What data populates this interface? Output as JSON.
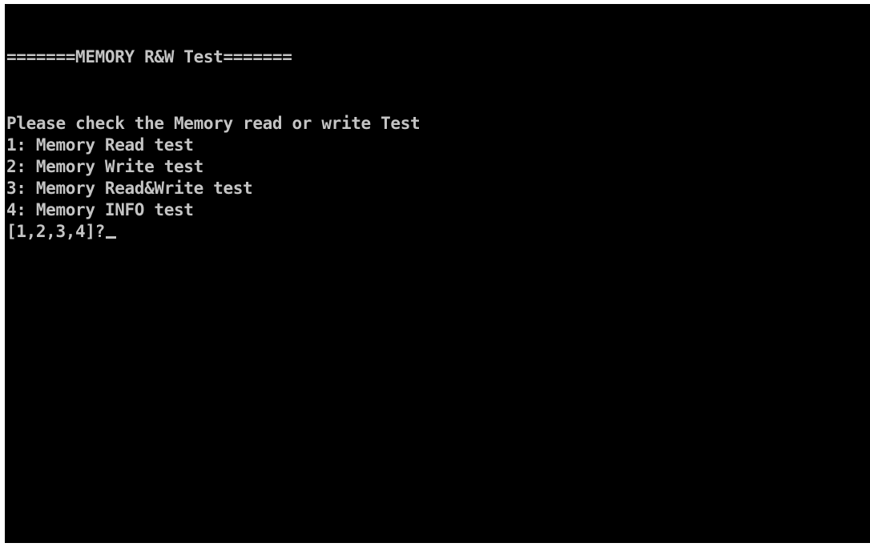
{
  "terminal": {
    "title": "=======MEMORY R&W Test=======",
    "prompt": "Please check the Memory read or write Test",
    "options": [
      "1: Memory Read test",
      "2: Memory Write test",
      "3: Memory Read&Write test",
      "4: Memory INFO test"
    ],
    "input_prompt": "[1,2,3,4]?",
    "input_value": ""
  },
  "colors": {
    "background": "#000000",
    "text": "#c4c4c4"
  }
}
